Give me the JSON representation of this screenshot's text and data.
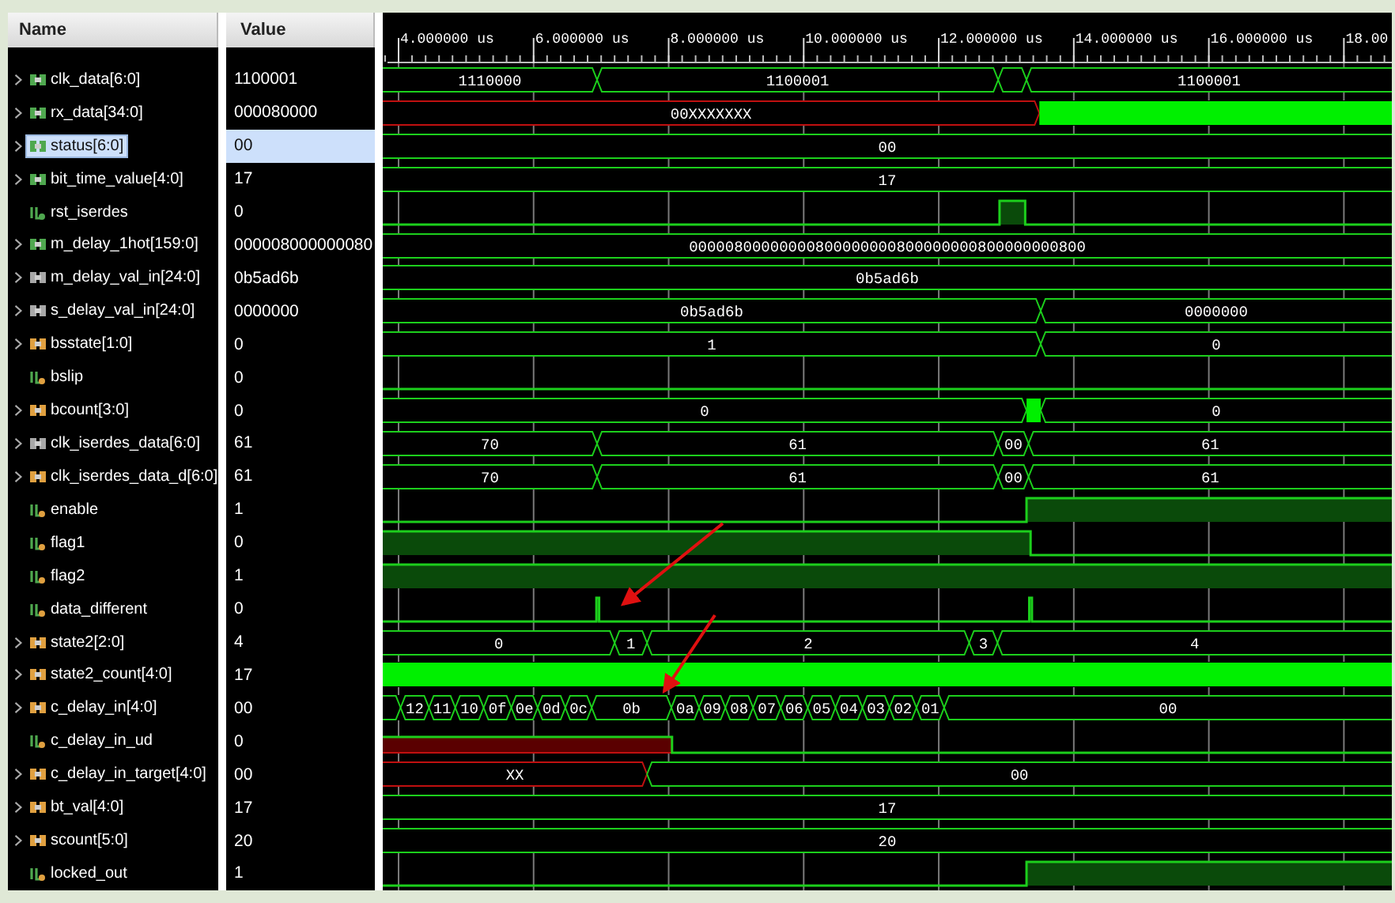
{
  "columns": {
    "name": "Name",
    "value": "Value"
  },
  "timeline": {
    "ticks": [
      {
        "label": "4.000000 us"
      },
      {
        "label": "6.000000 us"
      },
      {
        "label": "8.000000 us"
      },
      {
        "label": "10.000000 us"
      },
      {
        "label": "12.000000 us"
      },
      {
        "label": "14.000000 us"
      },
      {
        "label": "16.000000 us"
      },
      {
        "label": "18.00"
      }
    ]
  },
  "signals": [
    {
      "name": "clk_data[6:0]",
      "value": "1100001",
      "kind": "bus",
      "expanded": false,
      "color": "#4fa84f",
      "selected": false,
      "wave": [
        {
          "v": "1110000",
          "kind": "value"
        },
        {
          "v": "1100001",
          "kind": "value"
        },
        {
          "kind": "value"
        },
        {
          "v": "1100001",
          "kind": "value"
        }
      ]
    },
    {
      "name": "rx_data[34:0]",
      "value": "000080000",
      "kind": "bus",
      "expanded": false,
      "color": "#4fa84f",
      "selected": false,
      "wave": [
        {
          "v": "00XXXXXXX",
          "kind": "unknown"
        },
        {
          "kind": "dense"
        }
      ]
    },
    {
      "name": "status[6:0]",
      "value": "00",
      "kind": "bus",
      "expanded": false,
      "color": "#4fa84f",
      "selected": true,
      "wave": [
        {
          "v": "00",
          "kind": "value"
        }
      ]
    },
    {
      "name": "bit_time_value[4:0]",
      "value": "17",
      "kind": "bus",
      "expanded": false,
      "color": "#4fa84f",
      "selected": false,
      "wave": [
        {
          "v": "17",
          "kind": "value"
        }
      ]
    },
    {
      "name": "rst_iserdes",
      "value": "0",
      "kind": "bit",
      "color": "#4fa84f",
      "selected": false,
      "wave": [
        {
          "kind": "low"
        },
        {
          "kind": "high"
        },
        {
          "kind": "low"
        }
      ]
    },
    {
      "name": "m_delay_1hot[159:0]",
      "value": "000008000000080",
      "kind": "bus",
      "expanded": false,
      "color": "#4fa84f",
      "selected": false,
      "wave": [
        {
          "v": "00000800000000800000000800000000800000000800",
          "kind": "value"
        }
      ]
    },
    {
      "name": "m_delay_val_in[24:0]",
      "value": "0b5ad6b",
      "kind": "bus",
      "expanded": false,
      "color": "#a8a8a8",
      "selected": false,
      "wave": [
        {
          "v": "0b5ad6b",
          "kind": "value"
        }
      ]
    },
    {
      "name": "s_delay_val_in[24:0]",
      "value": "0000000",
      "kind": "bus",
      "expanded": false,
      "color": "#a8a8a8",
      "selected": false,
      "wave": [
        {
          "v": "0b5ad6b",
          "kind": "value"
        },
        {
          "v": "0000000",
          "kind": "value"
        }
      ]
    },
    {
      "name": "bsstate[1:0]",
      "value": "0",
      "kind": "bus",
      "expanded": false,
      "color": "#e0a040",
      "selected": false,
      "wave": [
        {
          "v": "1",
          "kind": "value"
        },
        {
          "v": "0",
          "kind": "value"
        }
      ]
    },
    {
      "name": "bslip",
      "value": "0",
      "kind": "bit",
      "color": "#e0a040",
      "selected": false,
      "wave": [
        {
          "kind": "low"
        }
      ]
    },
    {
      "name": "bcount[3:0]",
      "value": "0",
      "kind": "bus",
      "expanded": false,
      "color": "#e0a040",
      "selected": false,
      "wave": [
        {
          "v": "0",
          "kind": "value"
        },
        {
          "kind": "dense"
        },
        {
          "v": "0",
          "kind": "value"
        }
      ]
    },
    {
      "name": "clk_iserdes_data[6:0]",
      "value": "61",
      "kind": "bus",
      "expanded": false,
      "color": "#a8a8a8",
      "selected": false,
      "wave": [
        {
          "v": "70",
          "kind": "value"
        },
        {
          "v": "61",
          "kind": "value"
        },
        {
          "v": "00",
          "kind": "value"
        },
        {
          "v": "61",
          "kind": "value"
        }
      ]
    },
    {
      "name": "clk_iserdes_data_d[6:0]",
      "value": "61",
      "kind": "bus",
      "expanded": false,
      "color": "#e0a040",
      "selected": false,
      "wave": [
        {
          "v": "70",
          "kind": "value"
        },
        {
          "v": "61",
          "kind": "value"
        },
        {
          "v": "00",
          "kind": "value"
        },
        {
          "v": "61",
          "kind": "value"
        }
      ]
    },
    {
      "name": "enable",
      "value": "1",
      "kind": "bit",
      "color": "#e0a040",
      "selected": false,
      "wave": [
        {
          "kind": "low"
        },
        {
          "kind": "high"
        }
      ]
    },
    {
      "name": "flag1",
      "value": "0",
      "kind": "bit",
      "color": "#e0a040",
      "selected": false,
      "wave": [
        {
          "kind": "high"
        },
        {
          "kind": "low"
        }
      ]
    },
    {
      "name": "flag2",
      "value": "1",
      "kind": "bit",
      "color": "#e0a040",
      "selected": false,
      "wave": [
        {
          "kind": "high"
        }
      ]
    },
    {
      "name": "data_different",
      "value": "0",
      "kind": "bit",
      "color": "#e0a040",
      "selected": false,
      "wave": [
        {
          "kind": "low"
        },
        {
          "kind": "high"
        },
        {
          "kind": "low"
        },
        {
          "kind": "high"
        },
        {
          "kind": "low"
        }
      ]
    },
    {
      "name": "state2[2:0]",
      "value": "4",
      "kind": "bus",
      "expanded": false,
      "color": "#e0a040",
      "selected": false,
      "wave": [
        {
          "v": "0",
          "kind": "value"
        },
        {
          "v": "1",
          "kind": "value"
        },
        {
          "v": "2",
          "kind": "value"
        },
        {
          "v": "3",
          "kind": "value"
        },
        {
          "v": "4",
          "kind": "value"
        }
      ]
    },
    {
      "name": "state2_count[4:0]",
      "value": "17",
      "kind": "bus",
      "expanded": false,
      "color": "#e0a040",
      "selected": false,
      "wave": [
        {
          "kind": "dense"
        }
      ]
    },
    {
      "name": "c_delay_in[4:0]",
      "value": "00",
      "kind": "bus",
      "expanded": false,
      "color": "#e0a040",
      "selected": false,
      "wave": [
        {
          "kind": "value"
        },
        {
          "v": "12",
          "kind": "value"
        },
        {
          "v": "11",
          "kind": "value"
        },
        {
          "v": "10",
          "kind": "value"
        },
        {
          "v": "0f",
          "kind": "value"
        },
        {
          "v": "0e",
          "kind": "value"
        },
        {
          "v": "0d",
          "kind": "value"
        },
        {
          "v": "0c",
          "kind": "value"
        },
        {
          "v": "0b",
          "kind": "value"
        },
        {
          "v": "0a",
          "kind": "value"
        },
        {
          "v": "09",
          "kind": "value"
        },
        {
          "v": "08",
          "kind": "value"
        },
        {
          "v": "07",
          "kind": "value"
        },
        {
          "v": "06",
          "kind": "value"
        },
        {
          "v": "05",
          "kind": "value"
        },
        {
          "v": "04",
          "kind": "value"
        },
        {
          "v": "03",
          "kind": "value"
        },
        {
          "v": "02",
          "kind": "value"
        },
        {
          "v": "01",
          "kind": "value"
        },
        {
          "v": "00",
          "kind": "value"
        }
      ]
    },
    {
      "name": "c_delay_in_ud",
      "value": "0",
      "kind": "bit",
      "color": "#e0a040",
      "selected": false,
      "wave": [
        {
          "kind": "unknown"
        },
        {
          "kind": "low"
        }
      ]
    },
    {
      "name": "c_delay_in_target[4:0]",
      "value": "00",
      "kind": "bus",
      "expanded": false,
      "color": "#e0a040",
      "selected": false,
      "wave": [
        {
          "v": "XX",
          "kind": "unknown"
        },
        {
          "v": "00",
          "kind": "value"
        }
      ]
    },
    {
      "name": "bt_val[4:0]",
      "value": "17",
      "kind": "bus",
      "expanded": false,
      "color": "#e0a040",
      "selected": false,
      "wave": [
        {
          "v": "17",
          "kind": "value"
        }
      ]
    },
    {
      "name": "scount[5:0]",
      "value": "20",
      "kind": "bus",
      "expanded": false,
      "color": "#e0a040",
      "selected": false,
      "wave": [
        {
          "v": "20",
          "kind": "value"
        }
      ]
    },
    {
      "name": "locked_out",
      "value": "1",
      "kind": "bit",
      "color": "#e0a040",
      "selected": false,
      "wave": [
        {
          "kind": "low"
        },
        {
          "kind": "high"
        }
      ]
    }
  ]
}
